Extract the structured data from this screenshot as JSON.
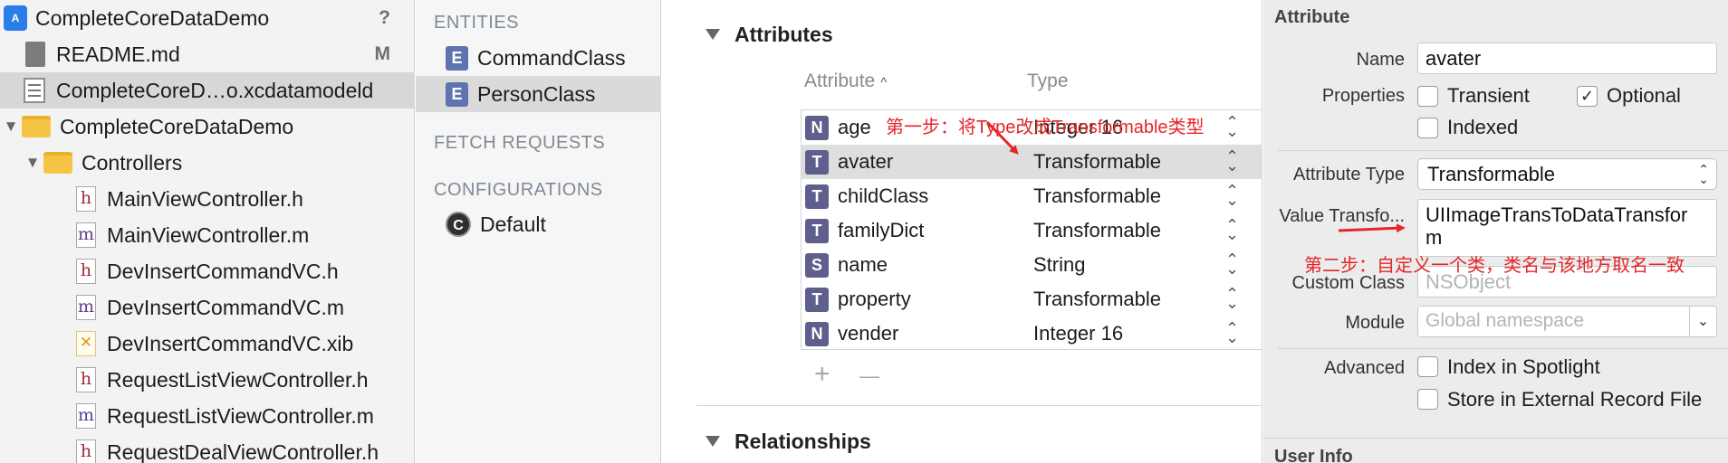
{
  "navigator": {
    "items": [
      {
        "label": "CompleteCoreDataDemo",
        "badge": "?",
        "icon": "project-icon"
      },
      {
        "label": "README.md",
        "badge": "M",
        "icon": "document-icon"
      },
      {
        "label": "CompleteCoreD…o.xcdatamodeld",
        "badge": "",
        "icon": "data-model-icon"
      },
      {
        "label": "CompleteCoreDataDemo",
        "badge": "",
        "icon": "folder-icon"
      },
      {
        "label": "Controllers",
        "badge": "",
        "icon": "folder-icon"
      },
      {
        "label": "MainViewController.h",
        "glyph": "h"
      },
      {
        "label": "MainViewController.m",
        "glyph": "m"
      },
      {
        "label": "DevInsertCommandVC.h",
        "glyph": "h"
      },
      {
        "label": "DevInsertCommandVC.m",
        "glyph": "m"
      },
      {
        "label": "DevInsertCommandVC.xib",
        "glyph": "✕"
      },
      {
        "label": "RequestListViewController.h",
        "glyph": "h"
      },
      {
        "label": "RequestListViewController.m",
        "glyph": "m"
      },
      {
        "label": "RequestDealViewController.h",
        "glyph": "h"
      }
    ]
  },
  "entities_panel": {
    "entities_header": "ENTITIES",
    "entities": [
      {
        "badge": "E",
        "label": "CommandClass"
      },
      {
        "badge": "E",
        "label": "PersonClass"
      }
    ],
    "fetch_header": "FETCH REQUESTS",
    "config_header": "CONFIGURATIONS",
    "configurations": [
      {
        "badge": "C",
        "label": "Default"
      }
    ]
  },
  "editor": {
    "attributes_title": "Attributes",
    "col_attribute": "Attribute",
    "col_type": "Type",
    "sort_arrow": "^",
    "attributes": [
      {
        "badge": "N",
        "name": "age",
        "type": "Integer 16"
      },
      {
        "badge": "T",
        "name": "avater",
        "type": "Transformable"
      },
      {
        "badge": "T",
        "name": "childClass",
        "type": "Transformable"
      },
      {
        "badge": "T",
        "name": "familyDict",
        "type": "Transformable"
      },
      {
        "badge": "S",
        "name": "name",
        "type": "String"
      },
      {
        "badge": "T",
        "name": "property",
        "type": "Transformable"
      },
      {
        "badge": "N",
        "name": "vender",
        "type": "Integer 16"
      }
    ],
    "stepper_glyph": "⌃\n⌄",
    "add_button": "+",
    "remove_button": "—",
    "relationships_title": "Relationships"
  },
  "inspector": {
    "header": "Attribute",
    "name_label": "Name",
    "name_value": "avater",
    "properties_label": "Properties",
    "transient_label": "Transient",
    "optional_label": "Optional",
    "indexed_label": "Indexed",
    "check_glyph": "✓",
    "attribute_type_label": "Attribute Type",
    "attribute_type_value": "Transformable",
    "value_transformer_label": "Value Transfo...",
    "value_transformer_value_1": "UIImageTransToDataTransfor",
    "value_transformer_value_2": "m",
    "custom_class_label": "Custom Class",
    "custom_class_placeholder": "NSObject",
    "module_label": "Module",
    "module_placeholder": "Global namespace",
    "advanced_label": "Advanced",
    "spotlight_label": "Index in Spotlight",
    "external_label": "Store in External Record File",
    "user_info_header": "User Info"
  },
  "annotations": {
    "step1": "第一步：将Type改成Transformable类型",
    "step2": "第二步：自定义一个类，类名与该地方取名一致",
    "color": "#e3262b"
  }
}
